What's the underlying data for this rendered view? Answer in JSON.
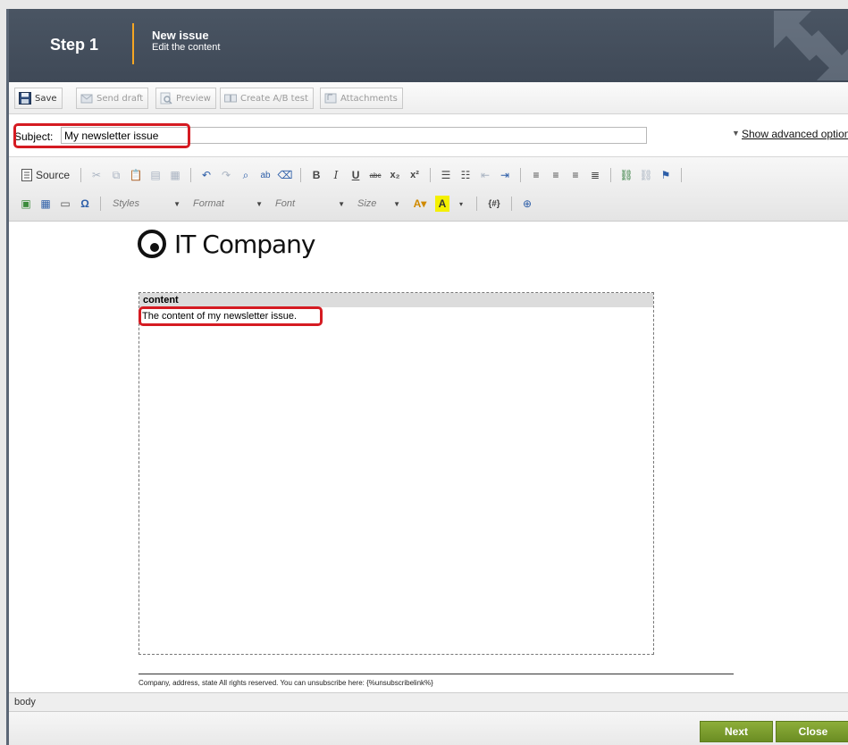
{
  "header": {
    "step_label": "Step 1",
    "title": "New issue",
    "subtitle": "Edit the content"
  },
  "toolbar": {
    "save": "Save",
    "send_draft": "Send draft",
    "preview": "Preview",
    "create_ab_test": "Create A/B test",
    "attachments": "Attachments"
  },
  "subject": {
    "label": "Subject:",
    "value": "My newsletter issue",
    "show_advanced": "Show advanced options"
  },
  "editor_toolbar": {
    "source": "Source",
    "styles": "Styles",
    "format": "Format",
    "font": "Font",
    "size": "Size",
    "macro": "{#}"
  },
  "editor": {
    "logo_text": "IT Company",
    "region_label": "content",
    "content_text": "The content of my newsletter issue.",
    "footer_text": "Company, address, state  All rights reserved.  You can unsubscribe here: {%unsubscribelink%}"
  },
  "statusbar": {
    "path": "body"
  },
  "actions": {
    "next": "Next",
    "close": "Close"
  },
  "colors": {
    "header_bg": "#434d5a",
    "accent_divider": "#f5a623",
    "highlight_red": "#d51b22",
    "button_green": "#7a9c2e"
  }
}
